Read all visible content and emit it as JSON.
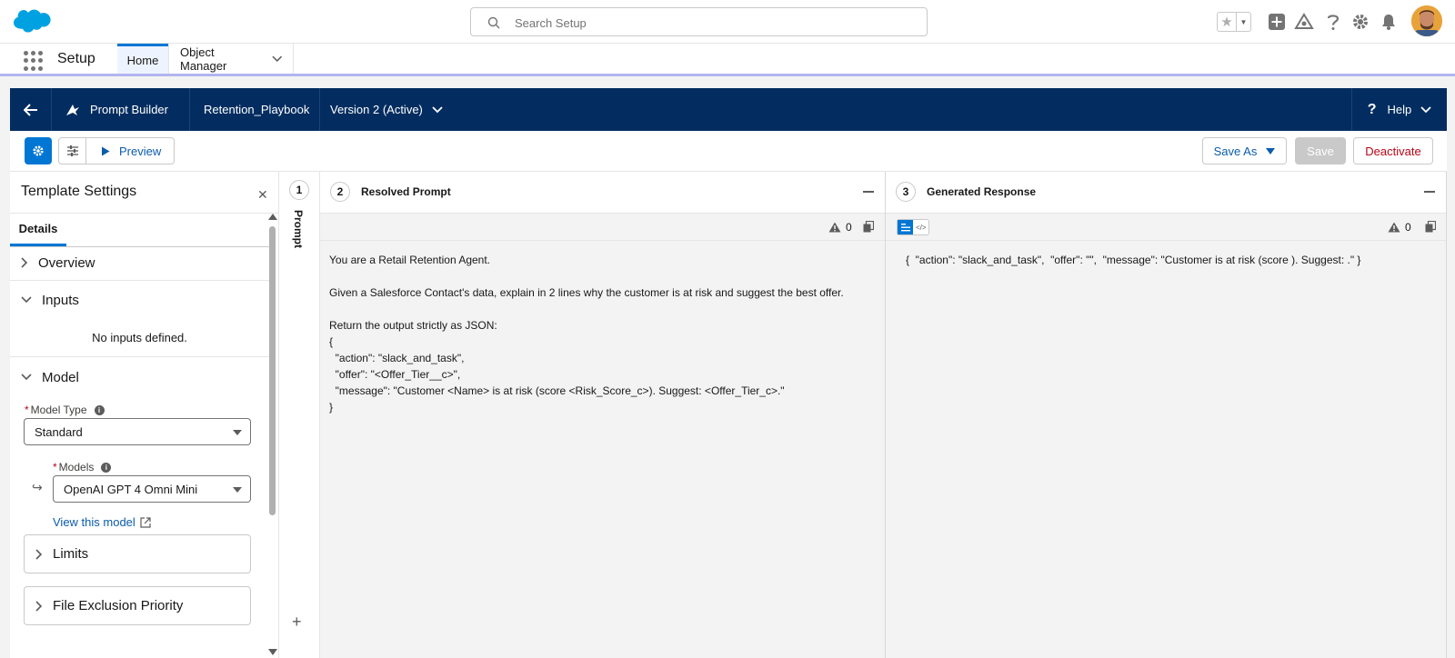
{
  "global_header": {
    "search_placeholder": "Search Setup"
  },
  "app_nav": {
    "app_name": "Setup",
    "tabs": [
      {
        "label": "Home",
        "active": true
      },
      {
        "label": "Object Manager",
        "active": false
      }
    ]
  },
  "builder_header": {
    "title": "Prompt Builder",
    "template_name": "Retention_Playbook",
    "version": "Version 2 (Active)",
    "help_label": "Help"
  },
  "toolbar": {
    "preview_label": "Preview",
    "save_as_label": "Save As",
    "save_label": "Save",
    "deactivate_label": "Deactivate"
  },
  "template_settings": {
    "title": "Template Settings",
    "tab_label": "Details",
    "sections": {
      "overview": "Overview",
      "inputs": "Inputs",
      "no_inputs": "No inputs defined.",
      "model": "Model",
      "limits": "Limits",
      "file_exclusion": "File Exclusion Priority"
    },
    "model_type": {
      "label": "Model Type",
      "value": "Standard"
    },
    "models": {
      "label": "Models",
      "value": "OpenAI GPT 4 Omni Mini"
    },
    "view_model_link": "View this model"
  },
  "steps": {
    "step1": {
      "number": "1",
      "label": "Prompt"
    },
    "step2": {
      "number": "2",
      "label": "Resolved Prompt"
    },
    "step3": {
      "number": "3",
      "label": "Generated Response"
    }
  },
  "resolved_prompt": {
    "warning_count": "0",
    "text": "You are a Retail Retention Agent.\n\nGiven a Salesforce Contact's data, explain in 2 lines why the customer is at risk and suggest the best offer.\n\nReturn the output strictly as JSON:\n{\n  \"action\": \"slack_and_task\",\n  \"offer\": \"<Offer_Tier__c>\",\n  \"message\": \"Customer <Name> is at risk (score <Risk_Score_c>). Suggest: <Offer_Tier_c>.\"\n}"
  },
  "generated_response": {
    "warning_count": "0",
    "text": "{  \"action\": \"slack_and_task\",  \"offer\": \"\",  \"message\": \"Customer is at risk (score ). Suggest: .\" }"
  },
  "colors": {
    "brand_blue": "#0176d3",
    "header_navy": "#032d60",
    "link_blue": "#0b5cab",
    "destructive_red": "#ba0517"
  }
}
